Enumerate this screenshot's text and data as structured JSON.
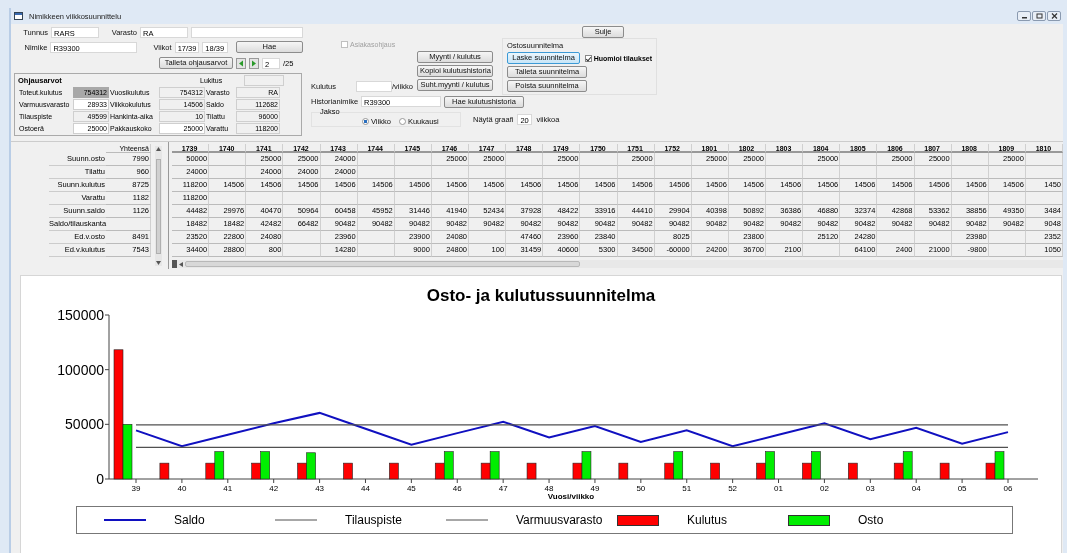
{
  "window": {
    "title": "Nimikkeen viikkosuunnittelu"
  },
  "item": {
    "tunnus_label": "Tunnus",
    "tunnus": "RARS",
    "varasto_label": "Varasto",
    "varasto": "RA",
    "nimike_label": "Nimike",
    "nimike": "R39300",
    "viikot_label": "Viikot",
    "from_week": "17/39",
    "to_week": "18/39",
    "search_button": "Hae"
  },
  "save_button": "Talleta ohjausarvot",
  "pager": {
    "page": "2",
    "total": "/25"
  },
  "asiakasohjaus": {
    "label": "Asiakasohjaus",
    "checked": false,
    "disabled": true
  },
  "ohjausarvot": {
    "title": "Ohjausarvot",
    "lock_label": "Lukitus",
    "fields": [
      {
        "label": "Toteut.kulutus",
        "value": "754312",
        "kind": "highlight"
      },
      {
        "label": "Vuosikulutus",
        "value": "754312",
        "kind": "readonly"
      },
      {
        "label": "Varasto",
        "value": "RA",
        "kind": "readonly"
      },
      {
        "label": "Varmuusvarasto",
        "value": "28933",
        "kind": "input"
      },
      {
        "label": "Viikkokulutus",
        "value": "14506",
        "kind": "readonly"
      },
      {
        "label": "Saldo",
        "value": "112682",
        "kind": "readonly"
      },
      {
        "label": "Tilauspiste",
        "value": "49599",
        "kind": "readonly"
      },
      {
        "label": "Hankinta-aika",
        "value": "10",
        "kind": "readonly"
      },
      {
        "label": "Tilattu",
        "value": "96000",
        "kind": "readonly"
      },
      {
        "label": "Ostoerä",
        "value": "25000",
        "kind": "input"
      },
      {
        "label": "Pakkauskoko",
        "value": "25000",
        "kind": "input"
      },
      {
        "label": "Varattu",
        "value": "118200",
        "kind": "readonly"
      }
    ]
  },
  "close_button": "Sulje",
  "actions": [
    "Myynti / kulutus",
    "Kopioi kulutushistoria",
    "Suht.myynti / kulutus"
  ],
  "kulutus": {
    "label": "Kulutus",
    "unit": "/viikko"
  },
  "ostosuunnitelma": {
    "title": "Ostosuunnitelma",
    "buttons": [
      {
        "label": "Laske suunnitelma",
        "focused": true
      },
      {
        "label": "Talleta suunnitelma",
        "focused": false
      },
      {
        "label": "Poista suunnitelma",
        "focused": false
      }
    ],
    "huomioi": {
      "label": "Huomioi tilaukset",
      "checked": true
    }
  },
  "historia": {
    "label": "Historianimike",
    "value": "R39300",
    "button": "Hae kulutushistoria"
  },
  "jakso": {
    "label": "Jakso",
    "options": [
      {
        "label": "Viikko",
        "selected": true
      },
      {
        "label": "Kuukausi",
        "selected": false
      }
    ],
    "graph_label": "Näytä graafi",
    "graph_weeks": "20",
    "graph_unit": "viikkoa"
  },
  "table": {
    "total_header": "Yhteensä",
    "columns": [
      "1739",
      "1740",
      "1741",
      "1742",
      "1743",
      "1744",
      "1745",
      "1746",
      "1747",
      "1748",
      "1749",
      "1750",
      "1751",
      "1752",
      "1801",
      "1802",
      "1803",
      "1804",
      "1805",
      "1806",
      "1807",
      "1808",
      "1809",
      "1810"
    ],
    "rows": [
      {
        "label": "Suunn.osto",
        "total": "7990",
        "cells": [
          "50000",
          null,
          "25000",
          "25000",
          "24000",
          null,
          null,
          "25000",
          "25000",
          null,
          "25000",
          null,
          "25000",
          null,
          "25000",
          "25000",
          null,
          "25000",
          null,
          "25000",
          "25000",
          null,
          "25000",
          null
        ]
      },
      {
        "label": "Tilattu",
        "total": "960",
        "cells": [
          "24000",
          null,
          "24000",
          "24000",
          "24000",
          null,
          null,
          null,
          null,
          null,
          null,
          null,
          null,
          null,
          null,
          null,
          null,
          null,
          null,
          null,
          null,
          null,
          null,
          null
        ]
      },
      {
        "label": "Suunn.kulutus",
        "total": "8725",
        "cells": [
          "118200",
          "14506",
          "14506",
          "14506",
          "14506",
          "14506",
          "14506",
          "14506",
          "14506",
          "14506",
          "14506",
          "14506",
          "14506",
          "14506",
          "14506",
          "14506",
          "14506",
          "14506",
          "14506",
          "14506",
          "14506",
          "14506",
          "14506",
          "1450"
        ]
      },
      {
        "label": "Varattu",
        "total": "1182",
        "cells": [
          "118200",
          null,
          null,
          null,
          null,
          null,
          null,
          null,
          null,
          null,
          null,
          null,
          null,
          null,
          null,
          null,
          null,
          null,
          null,
          null,
          null,
          null,
          null,
          null
        ]
      },
      {
        "label": "Suunn.saldo",
        "total": "1126",
        "cells": [
          "44482",
          "29976",
          "40470",
          "50964",
          "60458",
          "45952",
          "31446",
          "41940",
          "52434",
          "37928",
          "48422",
          "33916",
          "44410",
          "29904",
          "40398",
          "50892",
          "36386",
          "46880",
          "32374",
          "42868",
          "53362",
          "38856",
          "49350",
          "3484"
        ]
      },
      {
        "label": "Saldo/tilauskanta",
        "total": null,
        "cells": [
          "18482",
          "18482",
          "42482",
          "66482",
          "90482",
          "90482",
          "90482",
          "90482",
          "90482",
          "90482",
          "90482",
          "90482",
          "90482",
          "90482",
          "90482",
          "90482",
          "90482",
          "90482",
          "90482",
          "90482",
          "90482",
          "90482",
          "90482",
          "9048"
        ]
      },
      {
        "label": "Ed.v.osto",
        "total": "8491",
        "cells": [
          "23520",
          "22800",
          "24080",
          null,
          "23960",
          null,
          "23900",
          "24080",
          null,
          "47460",
          "23960",
          "23840",
          null,
          "8025",
          null,
          "23800",
          null,
          "25120",
          "24280",
          null,
          null,
          "23980",
          null,
          "2352"
        ]
      },
      {
        "label": "Ed.v.kulutus",
        "total": "7543",
        "cells": [
          "34400",
          "28800",
          "800",
          null,
          "14280",
          null,
          "9000",
          "24800",
          "100",
          "31459",
          "40600",
          "5300",
          "34500",
          "-60000",
          "24200",
          "36700",
          "2100",
          null,
          "64100",
          "2400",
          "21000",
          "-9800",
          null,
          "1050"
        ]
      }
    ]
  },
  "chart": {
    "chart_data": {
      "type": "bar",
      "title": "Osto- ja kulutussuunnitelma",
      "xlabel": "Vuosi/viikko",
      "categories": [
        "39",
        "40",
        "41",
        "42",
        "43",
        "44",
        "45",
        "46",
        "47",
        "48",
        "49",
        "50",
        "51",
        "52",
        "01",
        "02",
        "03",
        "04",
        "05",
        "06"
      ],
      "ylim": [
        0,
        150000
      ],
      "stacked": false,
      "legend": "bottom",
      "yticks": [
        0,
        50000,
        100000,
        150000
      ],
      "series": [
        {
          "name": "Saldo",
          "color": "#1010c0",
          "type": "line",
          "values": [
            44482,
            29976,
            40470,
            50964,
            60458,
            45952,
            31446,
            41940,
            52434,
            37928,
            48422,
            33916,
            44410,
            29904,
            40398,
            50892,
            36386,
            46880,
            32374,
            42868
          ]
        },
        {
          "name": "Tilauspiste",
          "color": "#505050",
          "type": "line",
          "values": [
            49599,
            49599,
            49599,
            49599,
            49599,
            49599,
            49599,
            49599,
            49599,
            49599,
            49599,
            49599,
            49599,
            49599,
            49599,
            49599,
            49599,
            49599,
            49599,
            49599
          ]
        },
        {
          "name": "Varmuusvarasto",
          "color": "#505050",
          "type": "line",
          "values": [
            28933,
            28933,
            28933,
            28933,
            28933,
            28933,
            28933,
            28933,
            28933,
            28933,
            28933,
            28933,
            28933,
            28933,
            28933,
            28933,
            28933,
            28933,
            28933,
            28933
          ]
        },
        {
          "name": "Kulutus",
          "color": "#ff0000",
          "type": "bar",
          "values": [
            118200,
            14506,
            14506,
            14506,
            14506,
            14506,
            14506,
            14506,
            14506,
            14506,
            14506,
            14506,
            14506,
            14506,
            14506,
            14506,
            14506,
            14506,
            14506,
            14506
          ]
        },
        {
          "name": "Osto",
          "color": "#00ee00",
          "type": "bar",
          "values": [
            50000,
            null,
            25000,
            25000,
            24000,
            null,
            null,
            25000,
            25000,
            null,
            25000,
            null,
            25000,
            null,
            25000,
            25000,
            null,
            25000,
            null,
            25000
          ]
        }
      ]
    }
  }
}
